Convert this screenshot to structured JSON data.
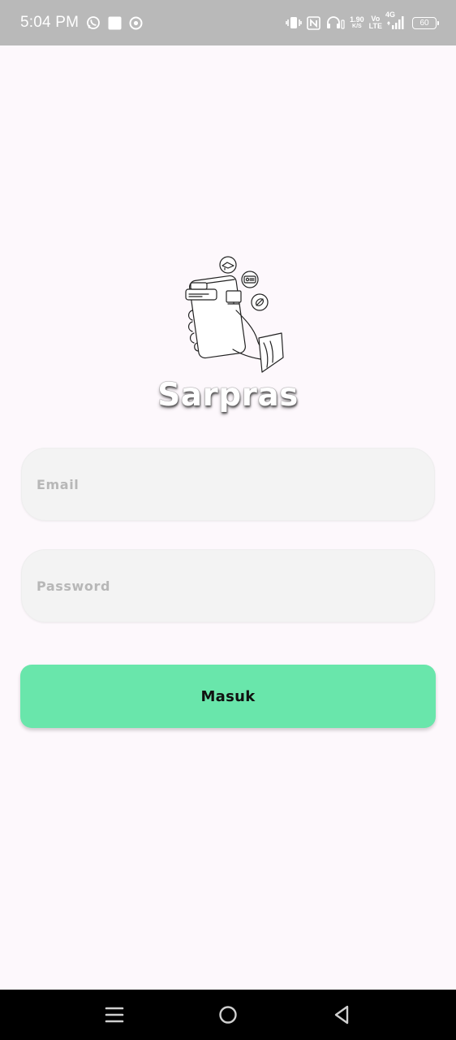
{
  "status_bar": {
    "time": "5:04 PM",
    "net_speed_value": "1.90",
    "net_speed_unit": "K/S",
    "volte_top": "Vo",
    "volte_bottom": "LTE",
    "network_type": "4G",
    "battery_level": "60",
    "icons": [
      "whatsapp-icon",
      "app-square-icon",
      "location-target-icon",
      "vibrate-icon",
      "nfc-icon",
      "headphones-icon",
      "signal-icon",
      "battery-icon"
    ]
  },
  "app": {
    "title": "Sarpras",
    "logo_icon": "hand-holding-phone-illustration"
  },
  "form": {
    "email_placeholder": "Email",
    "email_value": "",
    "password_placeholder": "Password",
    "password_value": "",
    "submit_label": "Masuk"
  },
  "colors": {
    "background": "#fdf8fc",
    "status_bar": "#b9b9b9",
    "field_bg": "#f3f3f3",
    "button": "#69e6ab",
    "nav_bar": "#000000"
  },
  "nav_bar": {
    "icons": [
      "menu-icon",
      "home-icon",
      "back-icon"
    ]
  }
}
